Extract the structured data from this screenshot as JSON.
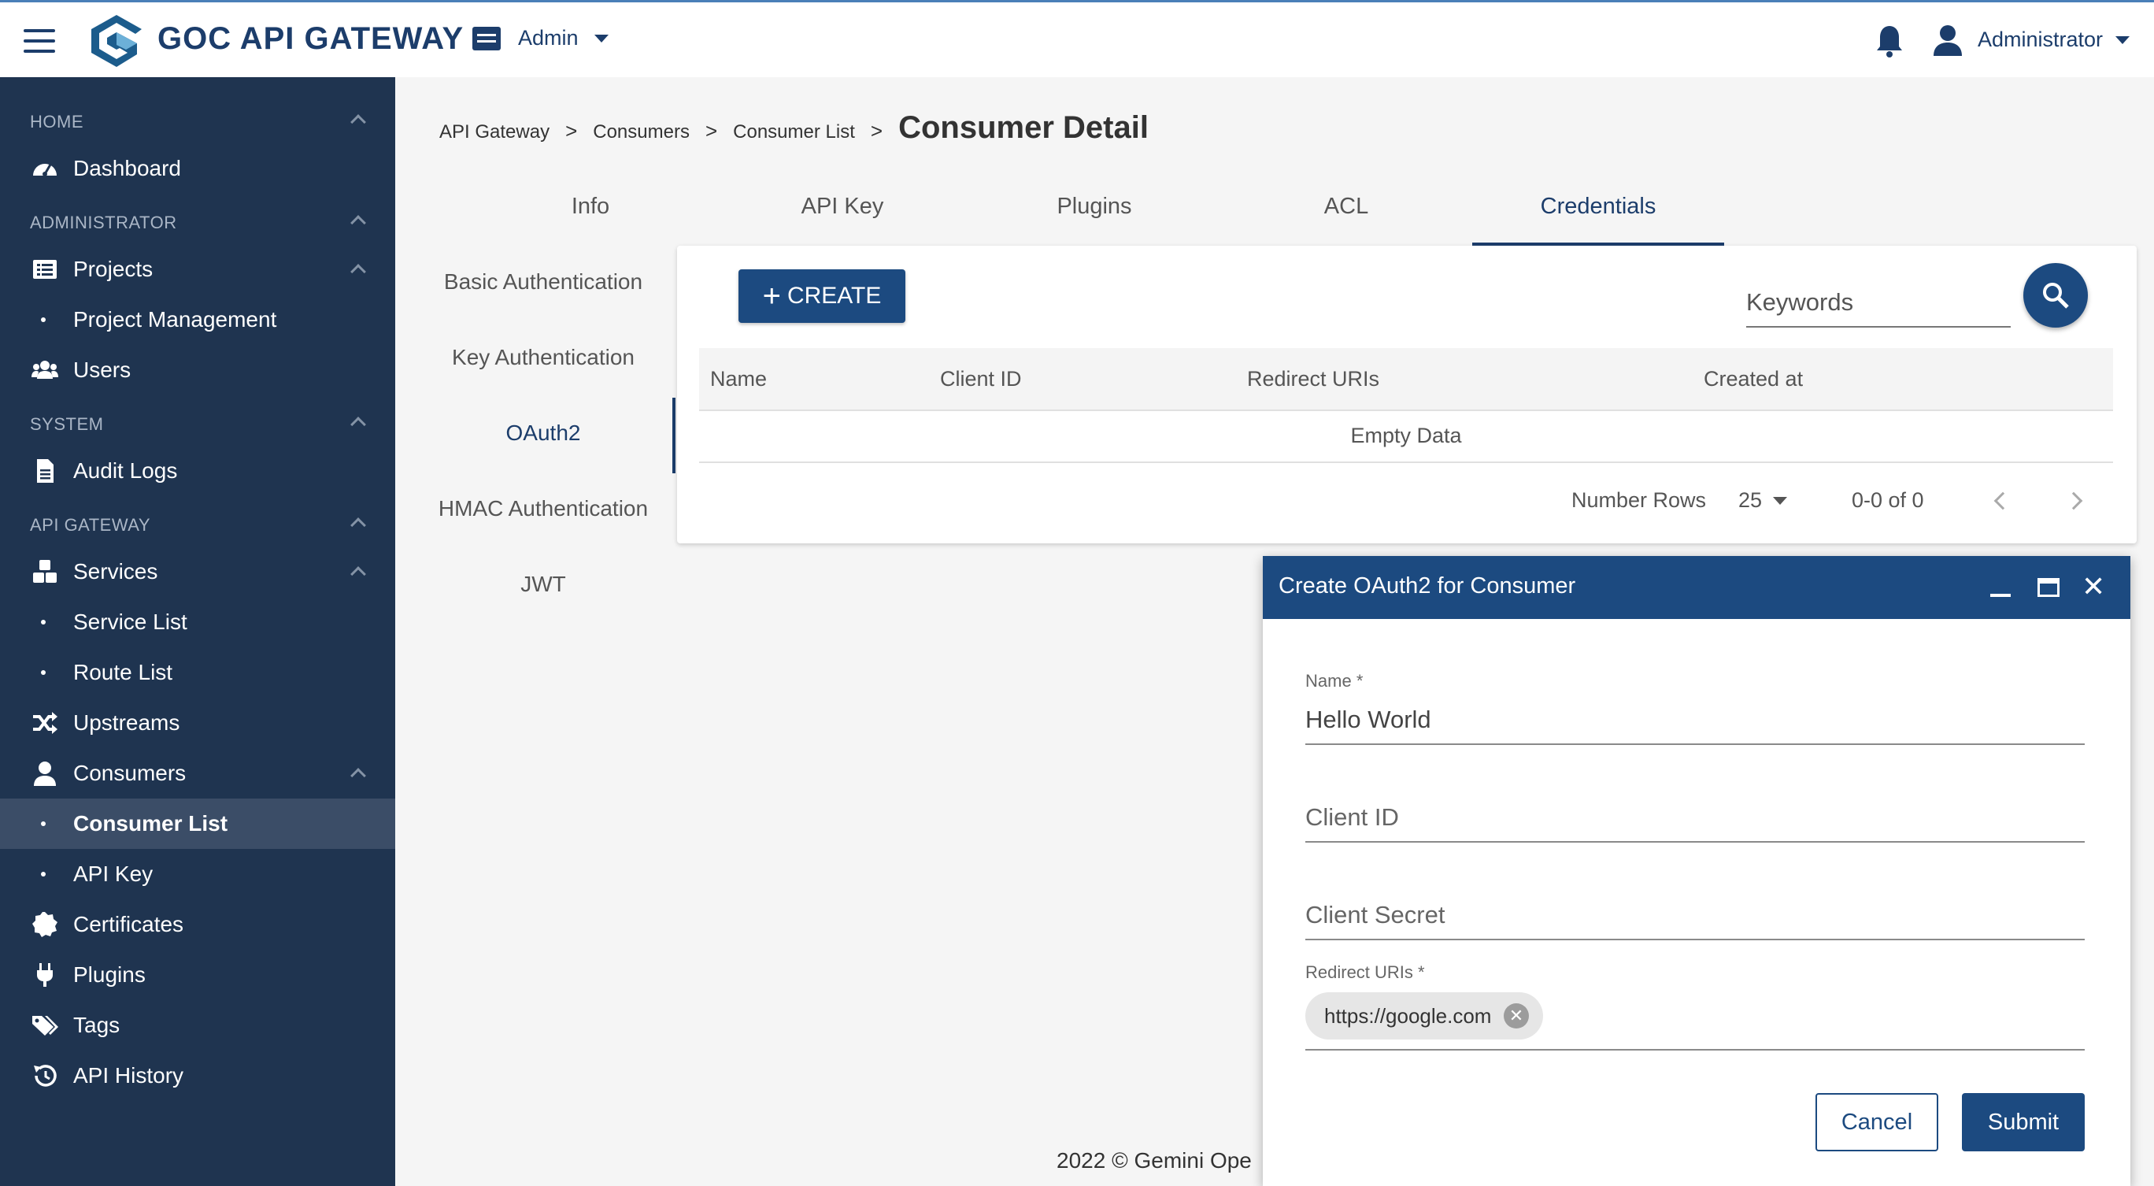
{
  "header": {
    "brand": "GOC API GATEWAY",
    "workspace": "Admin",
    "user": "Administrator"
  },
  "sidebar": {
    "sections": [
      "HOME",
      "ADMINISTRATOR",
      "SYSTEM",
      "API GATEWAY"
    ],
    "items": {
      "dashboard": "Dashboard",
      "projects": "Projects",
      "project_management": "Project Management",
      "users": "Users",
      "audit_logs": "Audit Logs",
      "services": "Services",
      "service_list": "Service List",
      "route_list": "Route List",
      "upstreams": "Upstreams",
      "consumers": "Consumers",
      "consumer_list": "Consumer List",
      "api_key": "API Key",
      "certificates": "Certificates",
      "plugins": "Plugins",
      "tags": "Tags",
      "api_history": "API History"
    }
  },
  "breadcrumb": {
    "items": [
      "API Gateway",
      "Consumers",
      "Consumer List"
    ],
    "separator": ">",
    "current": "Consumer Detail"
  },
  "tabs": [
    "Info",
    "API Key",
    "Plugins",
    "ACL",
    "Credentials"
  ],
  "active_tab": "Credentials",
  "subtabs": [
    "Basic Authentication",
    "Key Authentication",
    "OAuth2",
    "HMAC Authentication",
    "JWT"
  ],
  "active_subtab": "OAuth2",
  "table": {
    "create_label": "CREATE",
    "search_placeholder": "Keywords",
    "columns": [
      "Name",
      "Client ID",
      "Redirect URIs",
      "Created at"
    ],
    "empty_text": "Empty Data",
    "rows_label": "Number Rows",
    "rows_value": "25",
    "range": "0-0 of 0"
  },
  "footer": "2022 © Gemini Ope",
  "dialog": {
    "title": "Create OAuth2 for Consumer",
    "name_label": "Name",
    "name_value": "Hello World",
    "client_id_label": "Client ID",
    "client_secret_label": "Client Secret",
    "redirect_label": "Redirect URIs",
    "redirect_chip": "https://google.com",
    "required_mark": "*",
    "cancel": "Cancel",
    "submit": "Submit"
  },
  "colors": {
    "primary": "#1c4a80",
    "sidebar": "#1f3450",
    "sidebar_active": "#3b4d67"
  }
}
